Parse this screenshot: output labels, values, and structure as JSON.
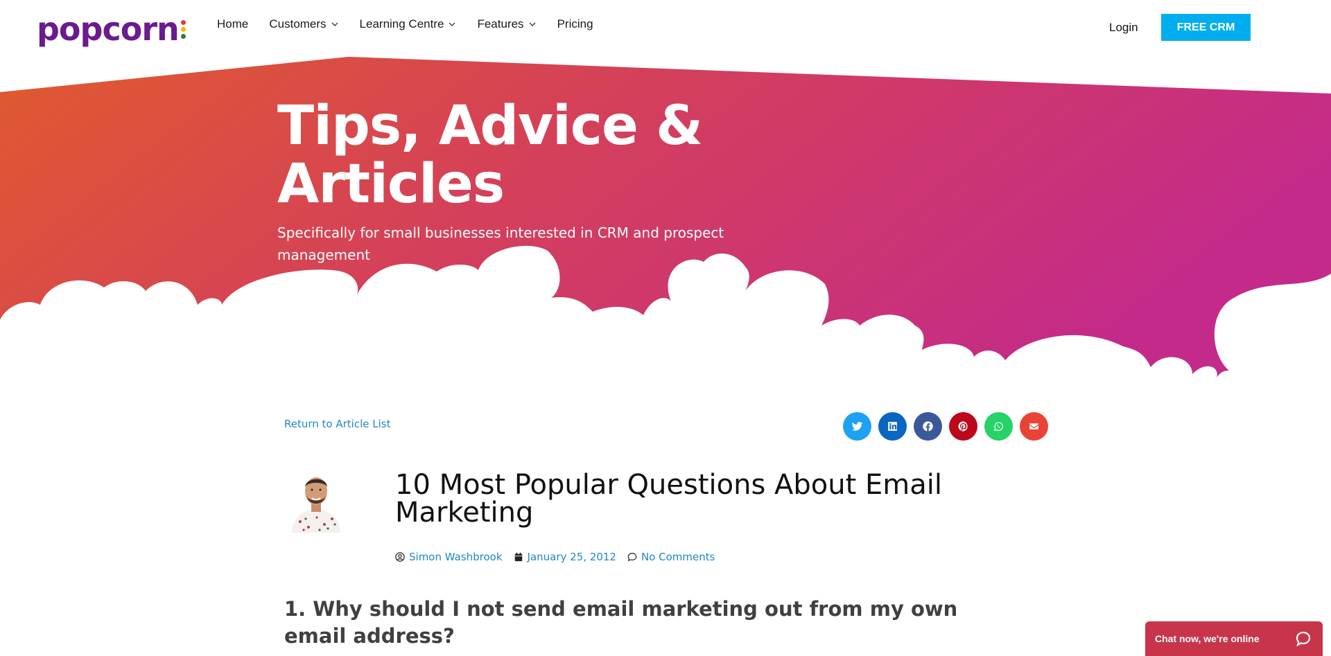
{
  "brand": {
    "name": "popcorn",
    "dot_colors": [
      "#e53935",
      "#f4b400",
      "#2e7d32"
    ],
    "purple": "#6a1b8f"
  },
  "nav": {
    "items": [
      {
        "label": "Home",
        "has_dropdown": false
      },
      {
        "label": "Customers",
        "has_dropdown": true
      },
      {
        "label": "Learning Centre",
        "has_dropdown": true
      },
      {
        "label": "Features",
        "has_dropdown": true
      },
      {
        "label": "Pricing",
        "has_dropdown": false
      }
    ],
    "login_label": "Login",
    "cta_label": "FREE CRM",
    "cta_color": "#00aeef"
  },
  "hero": {
    "title": "Tips, Advice & Articles",
    "subtitle": "Specifically for small businesses interested in CRM and prospect management",
    "gradient_start": "#e05a2e",
    "gradient_mid": "#d4405a",
    "gradient_end": "#c42a8a"
  },
  "article": {
    "return_label": "Return to Article List",
    "title": "10 Most Popular Questions About Email Marketing",
    "author": "Simon Washbrook",
    "date": "January 25, 2012",
    "comments": "No Comments",
    "first_heading": "1. Why should I not send email marketing out from my own email address?"
  },
  "share": [
    {
      "icon": "twitter-icon",
      "color": "#1da1f2"
    },
    {
      "icon": "linkedin-icon",
      "color": "#0a66c2"
    },
    {
      "icon": "facebook-icon",
      "color": "#3b5998"
    },
    {
      "icon": "pinterest-icon",
      "color": "#bd081c"
    },
    {
      "icon": "whatsapp-icon",
      "color": "#25d366"
    },
    {
      "icon": "email-icon",
      "color": "#ea4335"
    }
  ],
  "chat": {
    "label": "Chat now, we're online",
    "color": "#c8354a"
  }
}
